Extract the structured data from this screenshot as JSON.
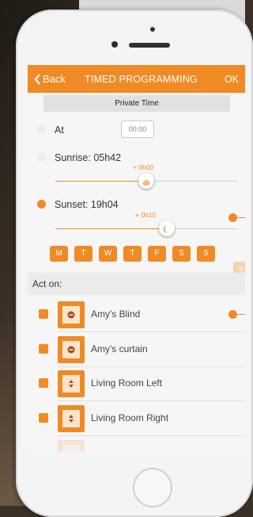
{
  "nav": {
    "back": "Back",
    "title": "TIMED PROGRAMMING",
    "ok": "OK"
  },
  "private_time": "Private Time",
  "at": {
    "label": "At",
    "time_placeholder": "00:00",
    "selected": false
  },
  "sunrise": {
    "label": "Sunrise: 05h42",
    "offset": "+ 0h00",
    "selected": false
  },
  "sunset": {
    "label": "Sunset: 19h04",
    "offset": "+ 0h15",
    "selected": true
  },
  "days": [
    "M",
    "T",
    "W",
    "T",
    "F",
    "S",
    "S"
  ],
  "help": "?",
  "act_on": {
    "label": "Act on:"
  },
  "devices": [
    {
      "name": "Amy's Blind",
      "icon": "blind-stop-icon",
      "checked": true
    },
    {
      "name": "Amy's curtain",
      "icon": "blind-stop-icon",
      "checked": true
    },
    {
      "name": "Living Room Left",
      "icon": "blind-updown-icon",
      "checked": true
    },
    {
      "name": "Living Room Right",
      "icon": "blind-updown-icon",
      "checked": true
    },
    {
      "name": "",
      "icon": "blind-icon",
      "checked": false
    }
  ],
  "colors": {
    "accent": "#f08a24",
    "divider": "#e0e0e0",
    "section": "#ebebeb"
  }
}
